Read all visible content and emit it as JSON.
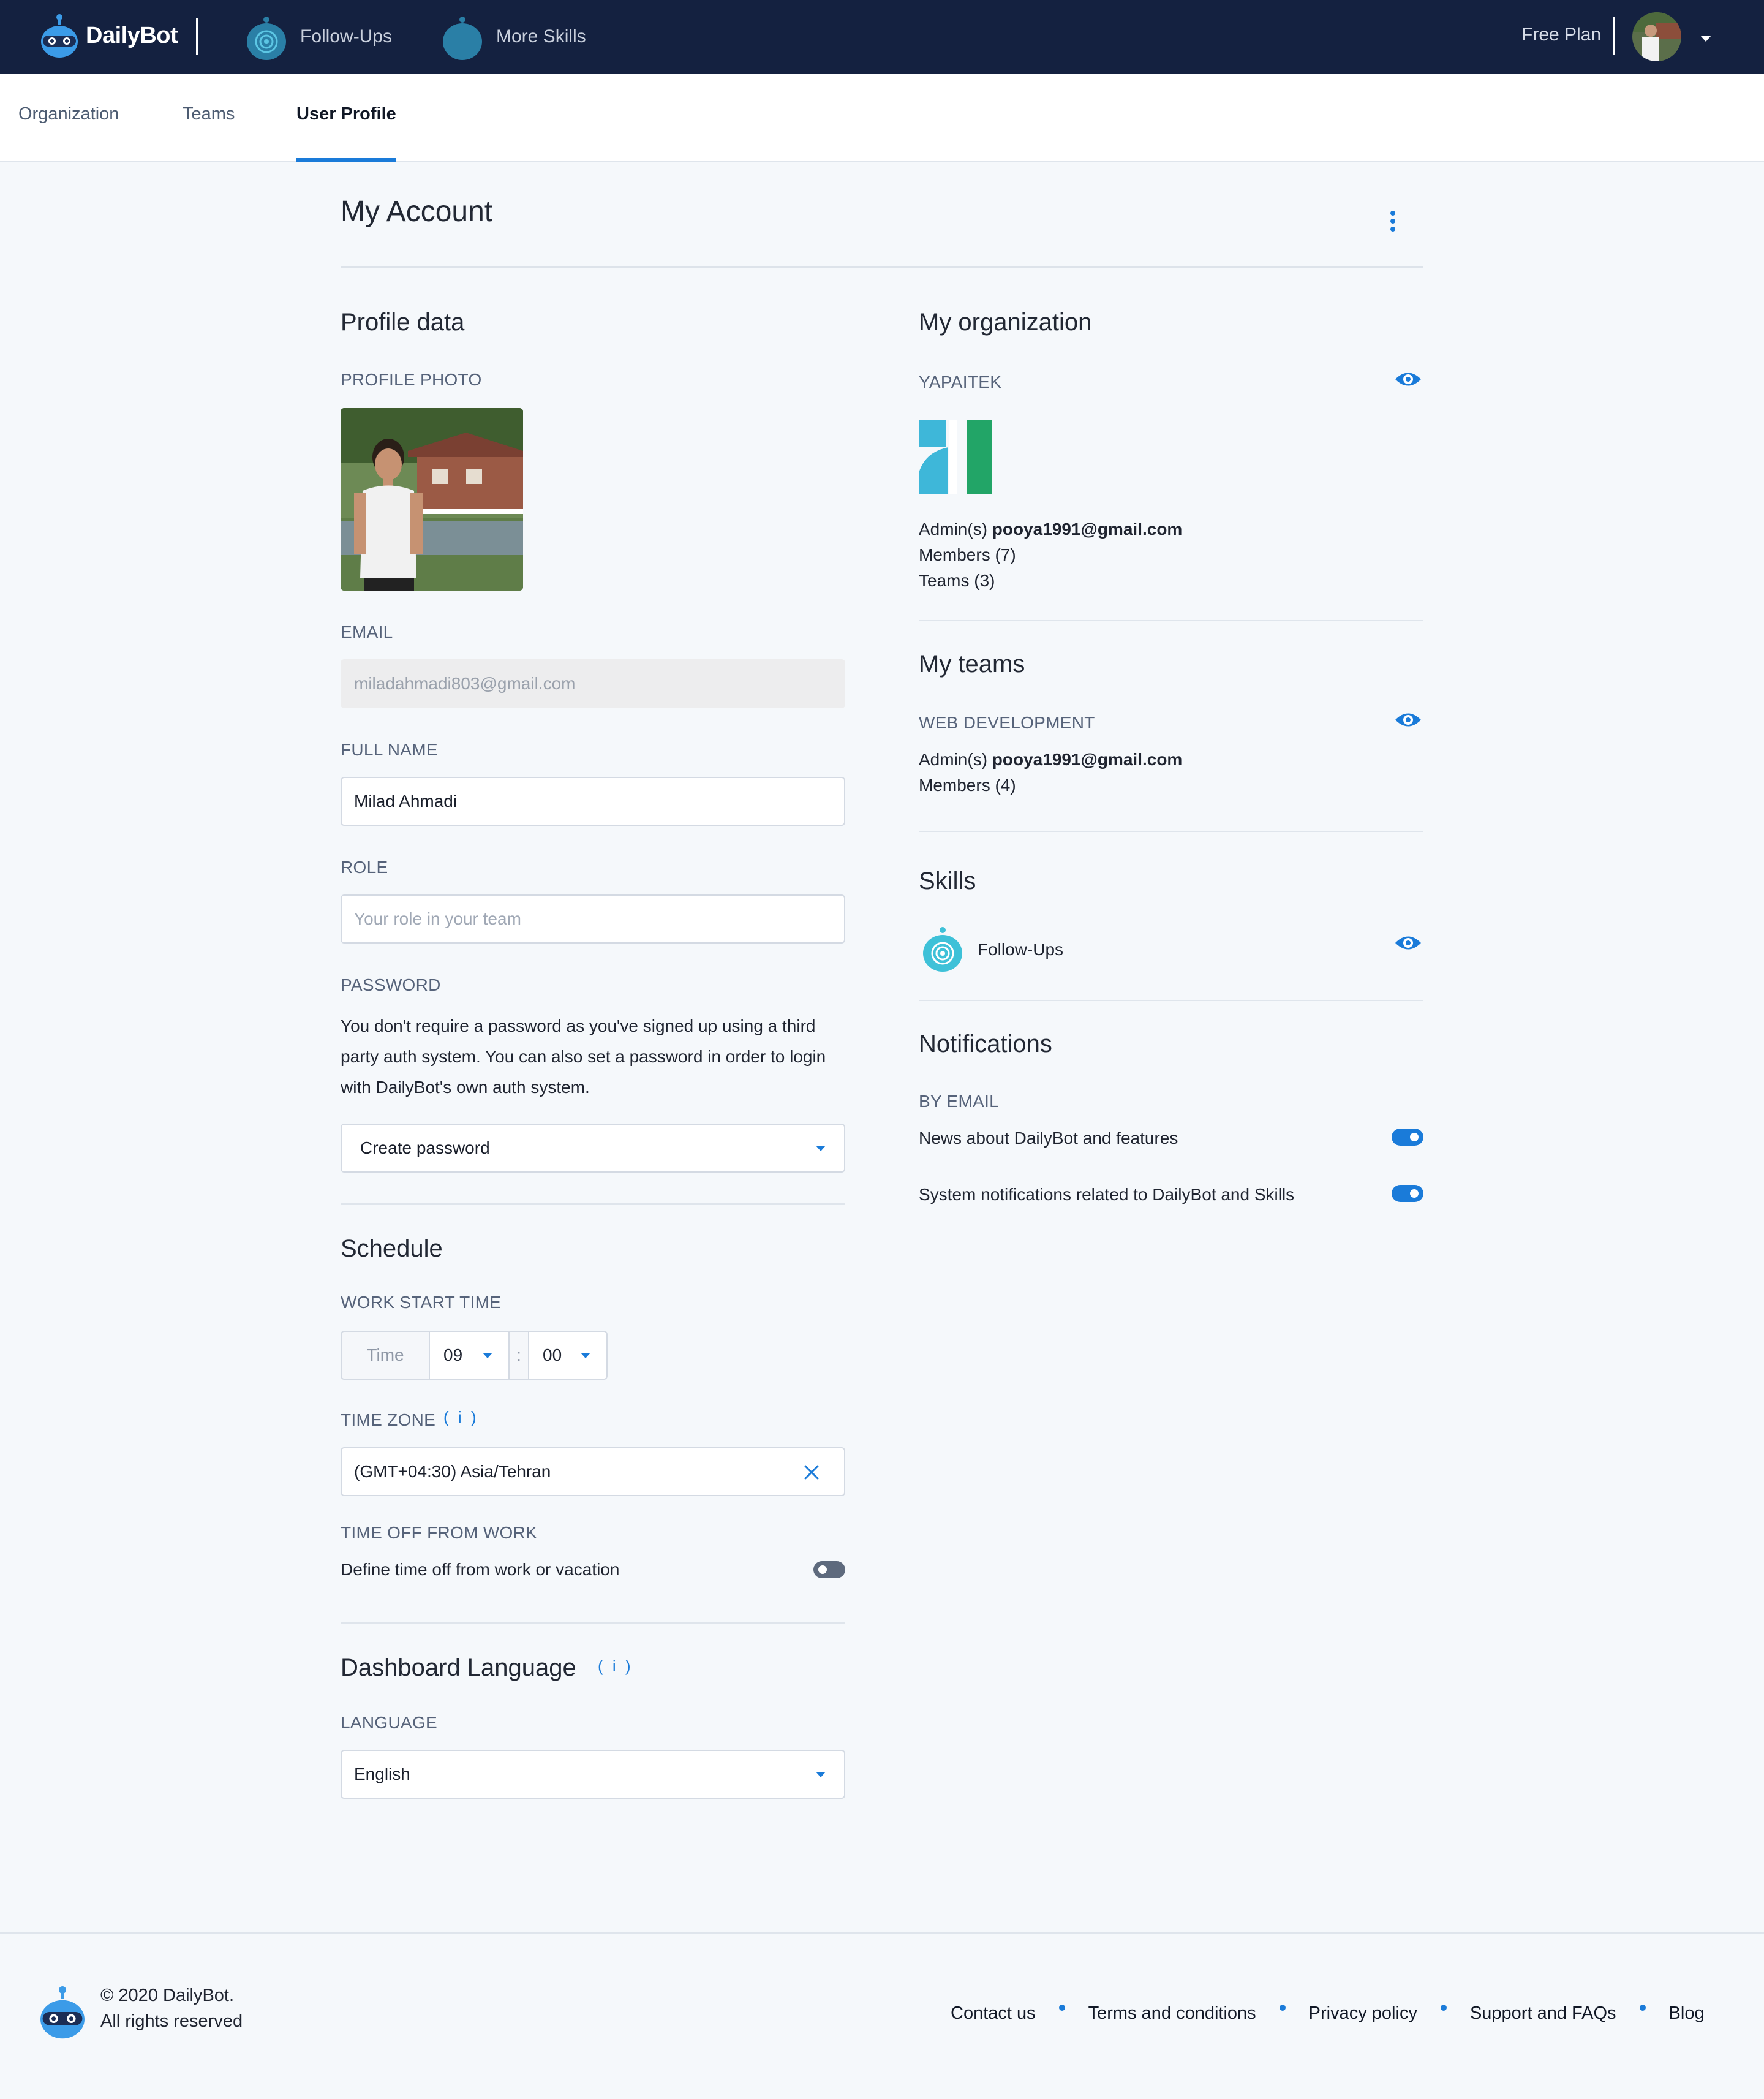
{
  "header": {
    "brand": "DailyBot",
    "nav": [
      {
        "label": "Follow-Ups",
        "icon": "follow-ups-icon"
      },
      {
        "label": "More Skills",
        "icon": "more-skills-icon"
      }
    ],
    "plan": "Free Plan",
    "avatar_icon": "user-avatar",
    "caret_icon": "caret-down-icon"
  },
  "subnav": {
    "tabs": [
      {
        "label": "Organization",
        "active": false
      },
      {
        "label": "Teams",
        "active": false
      },
      {
        "label": "User Profile",
        "active": true
      }
    ]
  },
  "page": {
    "title": "My Account",
    "menu_icon": "kebab-menu-icon"
  },
  "profile": {
    "heading": "Profile data",
    "photo_label": "PROFILE PHOTO",
    "email_label": "EMAIL",
    "email_value": "miladahmadi803@gmail.com",
    "full_name_label": "FULL NAME",
    "full_name_value": "Milad Ahmadi",
    "role_label": "ROLE",
    "role_placeholder": "Your role in your team",
    "password_label": "PASSWORD",
    "password_text": "You don't require a password as you've signed up using a third party auth system. You can also set a password in order to login with DailyBot's own auth system.",
    "password_select": "Create password"
  },
  "schedule": {
    "heading": "Schedule",
    "work_start_label": "WORK START TIME",
    "time_prefix": "Time",
    "hour": "09",
    "separator": ":",
    "minute": "00",
    "timezone_label": "TIME ZONE",
    "info_glyph": "( i )",
    "timezone_value": "(GMT+04:30) Asia/Tehran",
    "time_off_label": "TIME OFF FROM WORK",
    "time_off_text": "Define time off from work or vacation",
    "time_off_enabled": false
  },
  "language": {
    "heading": "Dashboard Language",
    "info_glyph": "( i )",
    "label": "LANGUAGE",
    "value": "English"
  },
  "organization": {
    "heading": "My organization",
    "name": "YAPAITEK",
    "admins_label": "Admin(s)",
    "admins_value": "pooya1991@gmail.com",
    "members": "Members (7)",
    "teams": "Teams (3)",
    "logo_colors": [
      "#3eb7d9",
      "#22a567"
    ]
  },
  "teams": {
    "heading": "My teams",
    "name": "WEB DEVELOPMENT",
    "admins_label": "Admin(s)",
    "admins_value": "pooya1991@gmail.com",
    "members": "Members (4)"
  },
  "skills": {
    "heading": "Skills",
    "items": [
      {
        "label": "Follow-Ups",
        "icon": "follow-ups-icon"
      }
    ]
  },
  "notifications": {
    "heading": "Notifications",
    "by_email_label": "BY EMAIL",
    "items": [
      {
        "label": "News about DailyBot and features",
        "enabled": true
      },
      {
        "label": "System notifications related to DailyBot and Skills",
        "enabled": true
      }
    ]
  },
  "footer": {
    "copyright": "© 2020 DailyBot.",
    "rights": "All rights reserved",
    "links": [
      "Contact us",
      "Terms and conditions",
      "Privacy policy",
      "Support and FAQs",
      "Blog"
    ]
  },
  "colors": {
    "nav_background": "#142140",
    "accent": "#1a7bd9",
    "page_background": "#f5f8fb"
  }
}
